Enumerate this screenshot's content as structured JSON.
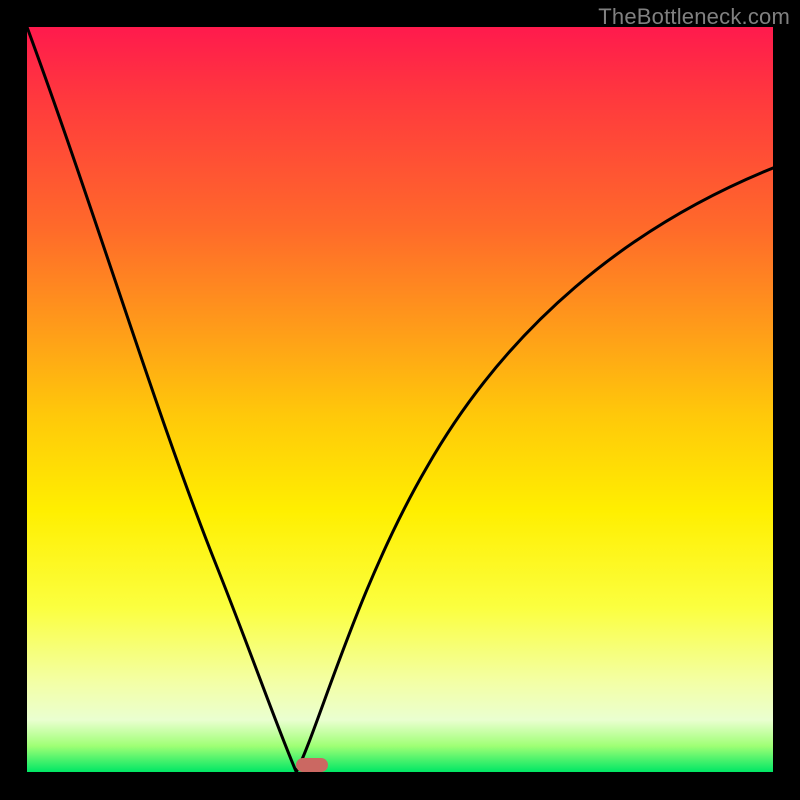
{
  "watermark": "TheBottleneck.com",
  "chart_data": {
    "type": "line",
    "title": "",
    "xlabel": "",
    "ylabel": "",
    "xlim": [
      0,
      1
    ],
    "ylim": [
      0,
      1
    ],
    "grid": false,
    "legend": false,
    "series": [
      {
        "name": "left-branch",
        "x": [
          0.0,
          0.035,
          0.07,
          0.105,
          0.14,
          0.175,
          0.21,
          0.245,
          0.28,
          0.315,
          0.345,
          0.361
        ],
        "values": [
          1.0,
          0.9,
          0.8,
          0.7,
          0.6,
          0.5,
          0.4,
          0.3,
          0.2,
          0.1,
          0.03,
          0.0
        ]
      },
      {
        "name": "right-branch",
        "x": [
          0.361,
          0.385,
          0.425,
          0.48,
          0.545,
          0.62,
          0.705,
          0.8,
          0.9,
          1.0
        ],
        "values": [
          0.0,
          0.05,
          0.15,
          0.28,
          0.4,
          0.51,
          0.605,
          0.69,
          0.755,
          0.81
        ]
      }
    ],
    "marker": {
      "x": 0.361,
      "y": 0.0,
      "color": "#cb6862"
    },
    "gradient_colors": {
      "top": "#ff1a4d",
      "mid": "#ffef00",
      "bottom": "#00e765"
    }
  }
}
